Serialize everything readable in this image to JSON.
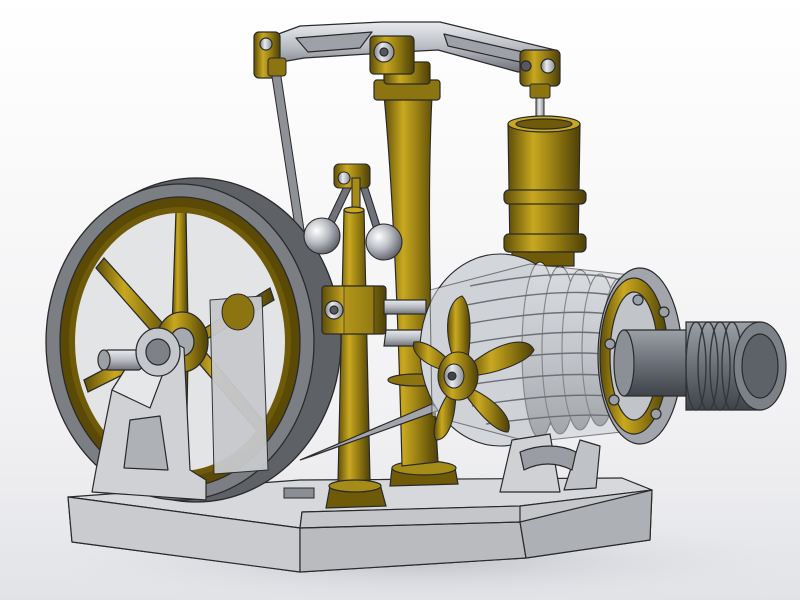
{
  "scene": {
    "subject": "stirling-beam-engine-cad-model",
    "colors": {
      "background_top": "#ffffff",
      "background_bottom": "#e6e6ea",
      "shadow": "#c9cbd2",
      "base_plate": "#cfd1d5",
      "base_edge": "#9a9ca1",
      "steel": "#bfc3c9",
      "steel_dark": "#7e8288",
      "steel_light": "#e9ebee",
      "brass": "#8c7410",
      "brass_light": "#c9a820",
      "brass_dark": "#5e4e08",
      "flywheel_rim": "#6a6e72",
      "outline": "#2a2a2a"
    }
  }
}
